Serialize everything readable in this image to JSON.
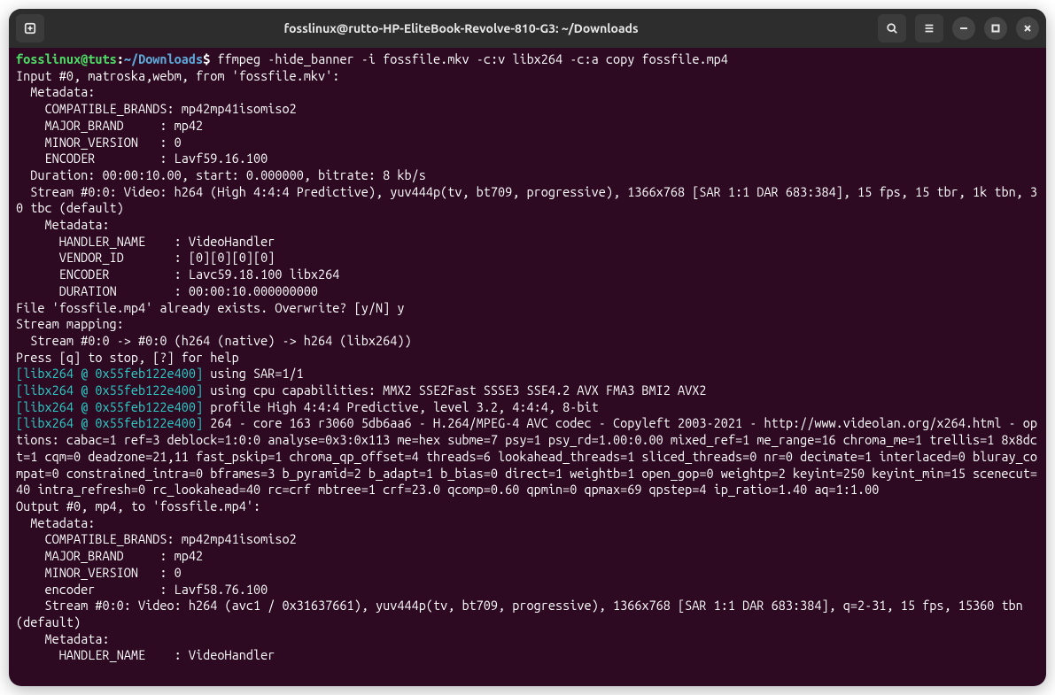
{
  "titlebar": {
    "title": "fosslinux@rutto-HP-EliteBook-Revolve-810-G3: ~/Downloads"
  },
  "prompt": {
    "user": "fosslinux",
    "host": "tuts",
    "path": "~/Downloads",
    "symbol": "$"
  },
  "command": "ffmpeg -hide_banner -i fossfile.mkv -c:v libx264 -c:a copy fossfile.mp4",
  "output": {
    "l01": "Input #0, matroska,webm, from 'fossfile.mkv':",
    "l02": "  Metadata:",
    "l03": "    COMPATIBLE_BRANDS: mp42mp41isomiso2",
    "l04": "    MAJOR_BRAND     : mp42",
    "l05": "    MINOR_VERSION   : 0",
    "l06": "    ENCODER         : Lavf59.16.100",
    "l07": "  Duration: 00:00:10.00, start: 0.000000, bitrate: 8 kb/s",
    "l08": "  Stream #0:0: Video: h264 (High 4:4:4 Predictive), yuv444p(tv, bt709, progressive), 1366x768 [SAR 1:1 DAR 683:384], 15 fps, 15 tbr, 1k tbn, 30 tbc (default)",
    "l09": "    Metadata:",
    "l10": "      HANDLER_NAME    : VideoHandler",
    "l11": "      VENDOR_ID       : [0][0][0][0]",
    "l12": "      ENCODER         : Lavc59.18.100 libx264",
    "l13": "      DURATION        : 00:00:10.000000000",
    "l14": "File 'fossfile.mp4' already exists. Overwrite? [y/N] y",
    "l15": "Stream mapping:",
    "l16": "  Stream #0:0 -> #0:0 (h264 (native) -> h264 (libx264))",
    "l17": "Press [q] to stop, [?] for help",
    "tag1": "[libx264 @ 0x55feb122e400]",
    "l18": " using SAR=1/1",
    "l19": " using cpu capabilities: MMX2 SSE2Fast SSSE3 SSE4.2 AVX FMA3 BMI2 AVX2",
    "l20": " profile High 4:4:4 Predictive, level 3.2, 4:4:4, 8-bit",
    "l21": " 264 - core 163 r3060 5db6aa6 - H.264/MPEG-4 AVC codec - Copyleft 2003-2021 - http://www.videolan.org/x264.html - options: cabac=1 ref=3 deblock=1:0:0 analyse=0x3:0x113 me=hex subme=7 psy=1 psy_rd=1.00:0.00 mixed_ref=1 me_range=16 chroma_me=1 trellis=1 8x8dct=1 cqm=0 deadzone=21,11 fast_pskip=1 chroma_qp_offset=4 threads=6 lookahead_threads=1 sliced_threads=0 nr=0 decimate=1 interlaced=0 bluray_compat=0 constrained_intra=0 bframes=3 b_pyramid=2 b_adapt=1 b_bias=0 direct=1 weightb=1 open_gop=0 weightp=2 keyint=250 keyint_min=15 scenecut=40 intra_refresh=0 rc_lookahead=40 rc=crf mbtree=1 crf=23.0 qcomp=0.60 qpmin=0 qpmax=69 qpstep=4 ip_ratio=1.40 aq=1:1.00",
    "l22": "Output #0, mp4, to 'fossfile.mp4':",
    "l23": "  Metadata:",
    "l24": "    COMPATIBLE_BRANDS: mp42mp41isomiso2",
    "l25": "    MAJOR_BRAND     : mp42",
    "l26": "    MINOR_VERSION   : 0",
    "l27": "    encoder         : Lavf58.76.100",
    "l28": "    Stream #0:0: Video: h264 (avc1 / 0x31637661), yuv444p(tv, bt709, progressive), 1366x768 [SAR 1:1 DAR 683:384], q=2-31, 15 fps, 15360 tbn (default)",
    "l29": "    Metadata:",
    "l30": "      HANDLER_NAME    : VideoHandler"
  }
}
